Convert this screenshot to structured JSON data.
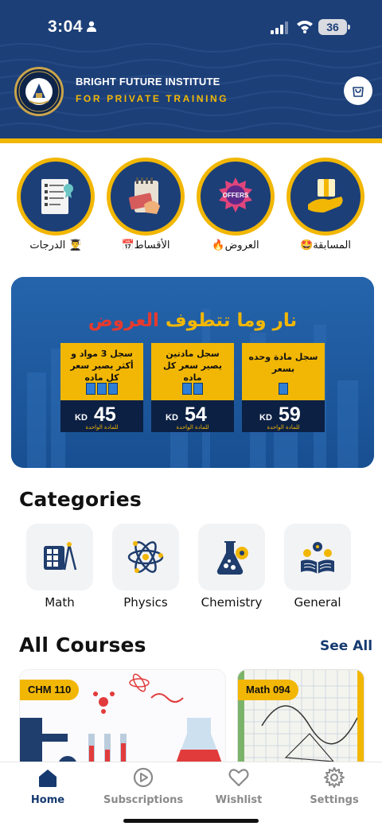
{
  "status_bar": {
    "time": "3:04",
    "battery": "36"
  },
  "header": {
    "institute_name": "BRIGHT FUTURE INSTITUTE",
    "institute_subtitle": "FOR PRIVATE TRAINING",
    "logo_text": "BRIGHT FUTURE INSTITUTE",
    "brand_color": "#1c3f78",
    "accent_color": "#f2b705"
  },
  "quick_links": [
    {
      "label": "الدرجات",
      "emoji": "👨‍🎓",
      "icon": "grades-document-icon"
    },
    {
      "label": "الأقساط",
      "emoji": "📅",
      "icon": "installments-card-icon"
    },
    {
      "label": "العروض",
      "emoji": "🔥",
      "icon": "offers-badge-icon"
    },
    {
      "label": "المسابقة",
      "emoji": "🤩",
      "icon": "gift-hand-icon"
    }
  ],
  "banner": {
    "title_highlight": "العروض",
    "title_rest": " نار وما تتطوف",
    "offers": [
      {
        "description": "سجل 3 مواد و أكثر يصير سعر كل ماده",
        "books": 3,
        "price": "45",
        "currency": "KD",
        "unit": "للمادة الواحدة"
      },
      {
        "description": "سجل مادتين يصير سعر كل ماده",
        "books": 2,
        "price": "54",
        "currency": "KD",
        "unit": "للمادة الواحدة"
      },
      {
        "description": "سجل مادة وحده بسعر",
        "books": 1,
        "price": "59",
        "currency": "KD",
        "unit": "للمادة الواحدة"
      }
    ]
  },
  "categories": {
    "title": "Categories",
    "items": [
      {
        "label": "Math",
        "icon": "calculator-icon"
      },
      {
        "label": "Physics",
        "icon": "atom-icon"
      },
      {
        "label": "Chemistry",
        "icon": "flask-icon"
      },
      {
        "label": "General",
        "icon": "open-book-gears-icon"
      }
    ]
  },
  "courses": {
    "title": "All Courses",
    "see_all": "See All",
    "items": [
      {
        "tag": "CHM 110"
      },
      {
        "tag": "Math 094"
      }
    ]
  },
  "bottom_nav": [
    {
      "label": "Home",
      "icon": "home-icon",
      "active": true
    },
    {
      "label": "Subscriptions",
      "icon": "play-circle-icon",
      "active": false
    },
    {
      "label": "Wishlist",
      "icon": "heart-icon",
      "active": false
    },
    {
      "label": "Settings",
      "icon": "gear-icon",
      "active": false
    }
  ]
}
